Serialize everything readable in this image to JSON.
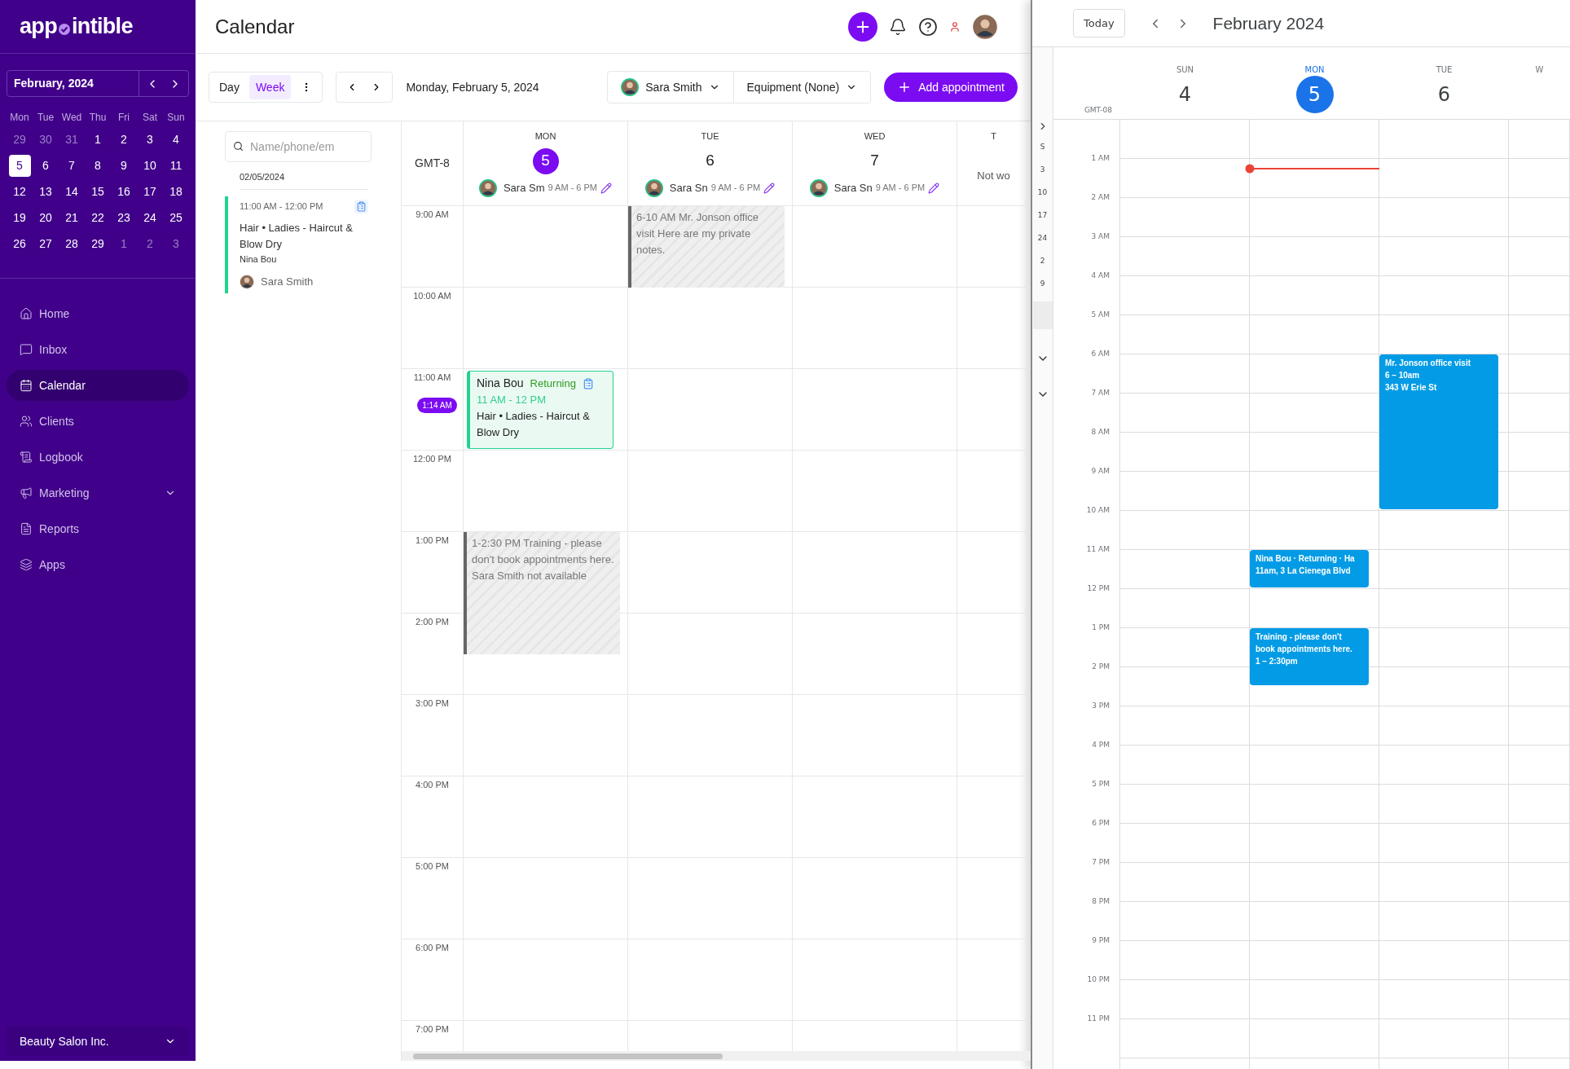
{
  "sidebar": {
    "logo": {
      "before": "app",
      "after": "intible"
    },
    "mini_calendar": {
      "title": "February, 2024",
      "weekdays": [
        "Mon",
        "Tue",
        "Wed",
        "Thu",
        "Fri",
        "Sat",
        "Sun"
      ],
      "weeks": [
        [
          {
            "label": "29",
            "outside": true,
            "selected": false
          },
          {
            "label": "30",
            "outside": true,
            "selected": false
          },
          {
            "label": "31",
            "outside": true,
            "selected": false
          },
          {
            "label": "1",
            "outside": false,
            "selected": false
          },
          {
            "label": "2",
            "outside": false,
            "selected": false
          },
          {
            "label": "3",
            "outside": false,
            "selected": false
          },
          {
            "label": "4",
            "outside": false,
            "selected": false
          }
        ],
        [
          {
            "label": "5",
            "outside": false,
            "selected": true
          },
          {
            "label": "6",
            "outside": false,
            "selected": false
          },
          {
            "label": "7",
            "outside": false,
            "selected": false
          },
          {
            "label": "8",
            "outside": false,
            "selected": false
          },
          {
            "label": "9",
            "outside": false,
            "selected": false
          },
          {
            "label": "10",
            "outside": false,
            "selected": false
          },
          {
            "label": "11",
            "outside": false,
            "selected": false
          }
        ],
        [
          {
            "label": "12",
            "outside": false,
            "selected": false
          },
          {
            "label": "13",
            "outside": false,
            "selected": false
          },
          {
            "label": "14",
            "outside": false,
            "selected": false
          },
          {
            "label": "15",
            "outside": false,
            "selected": false
          },
          {
            "label": "16",
            "outside": false,
            "selected": false
          },
          {
            "label": "17",
            "outside": false,
            "selected": false
          },
          {
            "label": "18",
            "outside": false,
            "selected": false
          }
        ],
        [
          {
            "label": "19",
            "outside": false,
            "selected": false
          },
          {
            "label": "20",
            "outside": false,
            "selected": false
          },
          {
            "label": "21",
            "outside": false,
            "selected": false
          },
          {
            "label": "22",
            "outside": false,
            "selected": false
          },
          {
            "label": "23",
            "outside": false,
            "selected": false
          },
          {
            "label": "24",
            "outside": false,
            "selected": false
          },
          {
            "label": "25",
            "outside": false,
            "selected": false
          }
        ],
        [
          {
            "label": "26",
            "outside": false,
            "selected": false
          },
          {
            "label": "27",
            "outside": false,
            "selected": false
          },
          {
            "label": "28",
            "outside": false,
            "selected": false
          },
          {
            "label": "29",
            "outside": false,
            "selected": false
          },
          {
            "label": "1",
            "outside": true,
            "selected": false
          },
          {
            "label": "2",
            "outside": true,
            "selected": false
          },
          {
            "label": "3",
            "outside": true,
            "selected": false
          }
        ]
      ]
    },
    "nav": [
      {
        "label": "Home",
        "selected": false,
        "expandable": false
      },
      {
        "label": "Inbox",
        "selected": false,
        "expandable": false
      },
      {
        "label": "Calendar",
        "selected": true,
        "expandable": false
      },
      {
        "label": "Clients",
        "selected": false,
        "expandable": false
      },
      {
        "label": "Logbook",
        "selected": false,
        "expandable": false
      },
      {
        "label": "Marketing",
        "selected": false,
        "expandable": true
      },
      {
        "label": "Reports",
        "selected": false,
        "expandable": false
      },
      {
        "label": "Apps",
        "selected": false,
        "expandable": false
      }
    ],
    "footer": {
      "label": "Beauty Salon Inc."
    }
  },
  "header": {
    "title": "Calendar"
  },
  "toolbar": {
    "views": [
      {
        "label": "Day",
        "selected": false
      },
      {
        "label": "Week",
        "selected": true
      }
    ],
    "date": "Monday, February 5, 2024",
    "staff": "Sara Smith",
    "equipment": "Equipment (None)",
    "add_button": "Add appointment"
  },
  "agenda": {
    "search": {
      "placeholder": "Name/phone/em"
    },
    "date": "02/05/2024",
    "appointments": [
      {
        "time": "11:00 AM - 12:00 PM",
        "service": "Hair • Ladies - Haircut & Blow Dry",
        "client": "Nina Bou",
        "staff": "Sara Smith"
      }
    ]
  },
  "grid": {
    "timezone": "GMT-8",
    "days": [
      {
        "weekday": "MON",
        "date": "5",
        "today": true,
        "staff": "Sara Sm",
        "hours": "9 AM - 6 PM",
        "events": [
          {
            "kind": "appointment",
            "name": "Nina Bou",
            "tag": "Returning",
            "time": "11 AM - 12 PM",
            "service": "Hair • Ladies - Haircut & Blow Dry"
          },
          {
            "kind": "blocked",
            "text": "1-2:30 PM Training - please don't book appointments here. Sara Smith not available"
          }
        ]
      },
      {
        "weekday": "TUE",
        "date": "6",
        "today": false,
        "staff": "Sara Sn",
        "hours": "9 AM - 6 PM",
        "events": [
          {
            "kind": "blocked",
            "text": "6-10 AM Mr. Jonson office visit Here are my private notes."
          }
        ]
      },
      {
        "weekday": "WED",
        "date": "7",
        "today": false,
        "staff": "Sara Sn",
        "hours": "9 AM - 6 PM"
      },
      {
        "weekday": "T",
        "note": "Not wo"
      }
    ],
    "hours": [
      {
        "label": "9:00 AM"
      },
      {
        "label": "10:00 AM"
      },
      {
        "label": "11:00 AM",
        "badge": "1:14 AM"
      },
      {
        "label": "12:00 PM"
      },
      {
        "label": "1:00 PM"
      },
      {
        "label": "2:00 PM"
      },
      {
        "label": "3:00 PM"
      },
      {
        "label": "4:00 PM"
      },
      {
        "label": "5:00 PM"
      },
      {
        "label": "6:00 PM"
      },
      {
        "label": "7:00 PM"
      }
    ]
  },
  "second_window": {
    "today_button": "Today",
    "title": "February 2024",
    "timezone": "GMT-08",
    "strip": [
      "S",
      "3",
      "10",
      "17",
      "24",
      "2",
      "9"
    ],
    "days": [
      {
        "weekday": "SUN",
        "date": "4",
        "today": false
      },
      {
        "weekday": "MON",
        "date": "5",
        "today": true,
        "events": [
          {
            "lines": [
              "Nina Bou · Returning · Ha",
              "11am, 3 La Cienega Blvd"
            ]
          },
          {
            "lines": [
              "Training - please don't",
              "book appointments here.",
              "1 – 2:30pm"
            ]
          }
        ]
      },
      {
        "weekday": "TUE",
        "date": "6",
        "today": false,
        "events": [
          {
            "lines": [
              "Mr. Jonson office visit",
              "6 – 10am",
              "343 W Erie St"
            ]
          }
        ]
      },
      {
        "weekday": "W",
        "today": false
      }
    ],
    "hours": [
      "1 AM",
      "2 AM",
      "3 AM",
      "4 AM",
      "5 AM",
      "6 AM",
      "7 AM",
      "8 AM",
      "9 AM",
      "10 AM",
      "11 AM",
      "12 PM",
      "1 PM",
      "2 PM",
      "3 PM",
      "4 PM",
      "5 PM",
      "6 PM",
      "7 PM",
      "8 PM",
      "9 PM",
      "10 PM",
      "11 PM"
    ]
  }
}
